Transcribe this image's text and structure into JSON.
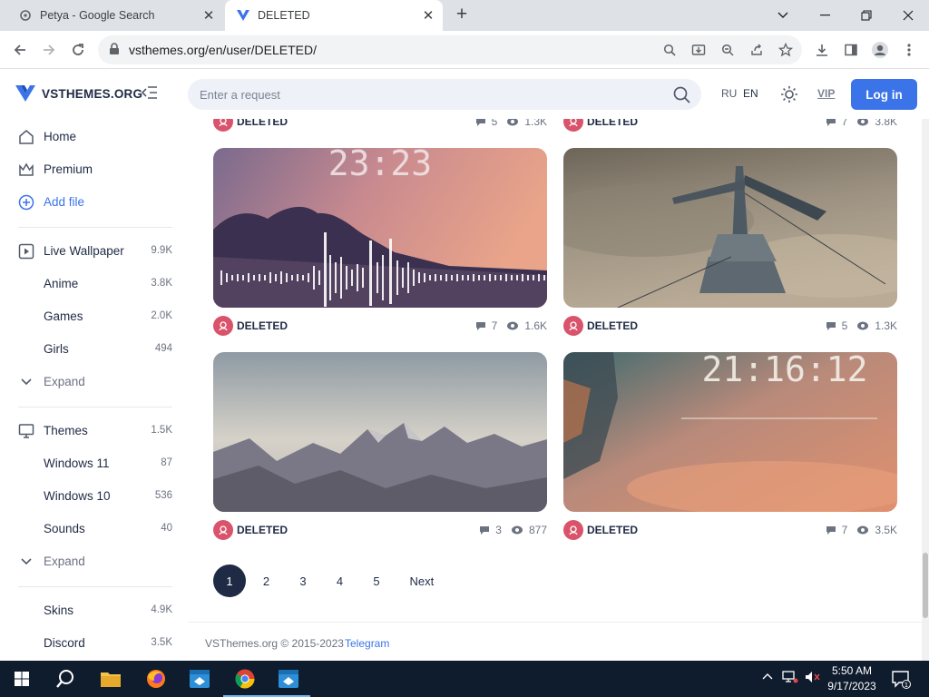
{
  "browser": {
    "tabs": [
      {
        "title": "Petya - Google Search",
        "active": false
      },
      {
        "title": "DELETED",
        "active": true
      }
    ],
    "url": "vsthemes.org/en/user/DELETED/"
  },
  "site": {
    "logo_text": "VSTHEMES.ORG",
    "search_placeholder": "Enter a request",
    "lang_ru": "RU",
    "lang_en": "EN",
    "vip": "VIP",
    "login": "Log in",
    "accent_color": "#3b74e8"
  },
  "sidebar": {
    "items": [
      {
        "label": "Home",
        "icon": "home-icon"
      },
      {
        "label": "Premium",
        "icon": "crown-icon"
      },
      {
        "label": "Add file",
        "icon": "add-circle-icon"
      },
      {
        "label": "Live Wallpaper",
        "count": "9.9K",
        "icon": "play-square-icon"
      },
      {
        "label": "Anime",
        "count": "3.8K"
      },
      {
        "label": "Games",
        "count": "2.0K"
      },
      {
        "label": "Girls",
        "count": "494"
      },
      {
        "label": "Expand",
        "icon": "chevron-down-icon"
      },
      {
        "label": "Themes",
        "count": "1.5K",
        "icon": "monitor-icon"
      },
      {
        "label": "Windows 11",
        "count": "87"
      },
      {
        "label": "Windows 10",
        "count": "536"
      },
      {
        "label": "Sounds",
        "count": "40"
      },
      {
        "label": "Expand",
        "icon": "chevron-down-icon"
      },
      {
        "label": "Skins",
        "count": "4.9K"
      },
      {
        "label": "Discord",
        "count": "3.5K"
      }
    ]
  },
  "cards": [
    {
      "author": "DELETED",
      "comments": "5",
      "views": "1.3K",
      "thumb": "partial-top"
    },
    {
      "author": "DELETED",
      "comments": "7",
      "views": "3.8K",
      "thumb": "partial-top"
    },
    {
      "author": "DELETED",
      "comments": "7",
      "views": "1.6K",
      "thumb": "sunset-forest-clock",
      "clock_text": "23:23"
    },
    {
      "author": "DELETED",
      "comments": "5",
      "views": "1.3K",
      "thumb": "floating-tower"
    },
    {
      "author": "DELETED",
      "comments": "3",
      "views": "877",
      "thumb": "mountains"
    },
    {
      "author": "DELETED",
      "comments": "7",
      "views": "3.5K",
      "thumb": "scifi-clouds-clock",
      "clock_text": "21:16:12"
    }
  ],
  "pagination": {
    "pages": [
      "1",
      "2",
      "3",
      "4",
      "5"
    ],
    "current": "1",
    "next": "Next"
  },
  "footer": {
    "copyright": "VSThemes.org © 2015-2023",
    "telegram": "Telegram"
  },
  "taskbar": {
    "time": "5:50 AM",
    "date": "9/17/2023",
    "notifications": "1"
  }
}
